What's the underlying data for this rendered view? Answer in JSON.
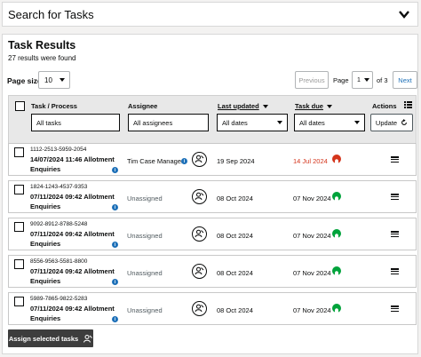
{
  "search_panel": {
    "title": "Search for Tasks"
  },
  "results": {
    "heading": "Task Results",
    "found_text": "27 results were found",
    "page_size_label": "Page size",
    "page_size_value": "10",
    "previous_label": "Previous",
    "page_label": "Page",
    "page_value": "1",
    "of_label": "of 3",
    "next_label": "Next"
  },
  "columns": {
    "task": "Task / Process",
    "assignee": "Assignee",
    "last_updated": "Last updated",
    "task_due": "Task due",
    "actions": "Actions"
  },
  "filters": {
    "task_placeholder": "All tasks",
    "assignee_placeholder": "All assignees",
    "updated_value": "All dates",
    "due_value": "All dates",
    "update_label": "Update"
  },
  "rows": [
    {
      "ref": "1112-2513-5959-2054",
      "name_line1": "14/07/2024 11:46 Allotment",
      "name_line2": "Enquiries",
      "assignee": "Tim Case Manager",
      "updated": "19 Sep 2024",
      "due": "14 Jul 2024",
      "status": "overdue"
    },
    {
      "ref": "1824-1243-4537-9353",
      "name_line1": "07/11/2024 09:42 Allotment",
      "name_line2": "Enquiries",
      "assignee": "Unassigned",
      "updated": "08 Oct 2024",
      "due": "07 Nov 2024",
      "status": "ok"
    },
    {
      "ref": "9092-8912-8788-5248",
      "name_line1": "07/11/2024 09:42 Allotment",
      "name_line2": "Enquiries",
      "assignee": "Unassigned",
      "updated": "08 Oct 2024",
      "due": "07 Nov 2024",
      "status": "ok"
    },
    {
      "ref": "8556-9563-5581-8800",
      "name_line1": "07/11/2024 09:42 Allotment",
      "name_line2": "Enquiries",
      "assignee": "Unassigned",
      "updated": "08 Oct 2024",
      "due": "07 Nov 2024",
      "status": "ok"
    },
    {
      "ref": "5989-7865-9822-5283",
      "name_line1": "07/11/2024 09:42 Allotment",
      "name_line2": "Enquiries",
      "assignee": "Unassigned",
      "updated": "08 Oct 2024",
      "due": "07 Nov 2024",
      "status": "ok"
    }
  ],
  "footer": {
    "assign_selected_label": "Assign selected tasks"
  },
  "icons": {
    "expand": "chevron-down-icon",
    "info": "info-icon",
    "assign": "assign-user-icon",
    "status_ok": "bell-icon",
    "status_overdue": "bell-icon",
    "menu": "hamburger-menu-icon",
    "list_view": "list-view-icon",
    "refresh": "refresh-icon"
  },
  "colors": {
    "link": "#1d70b8",
    "overdue": "#d4351c",
    "ok": "#00a33b",
    "button_dark": "#3d3d3d"
  }
}
